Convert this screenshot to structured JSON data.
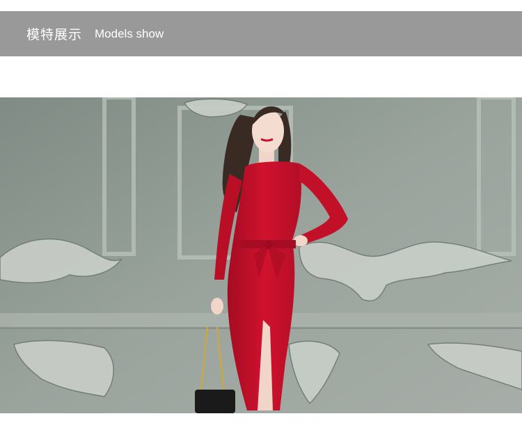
{
  "header": {
    "title_cn": "模特展示",
    "title_en": "Models show"
  },
  "photo": {
    "subject": "model-photo",
    "colors": {
      "wall": "#98a29b",
      "dress": "#c8102e",
      "hair": "#3a2a24",
      "bag": "#1a1a1a"
    }
  }
}
